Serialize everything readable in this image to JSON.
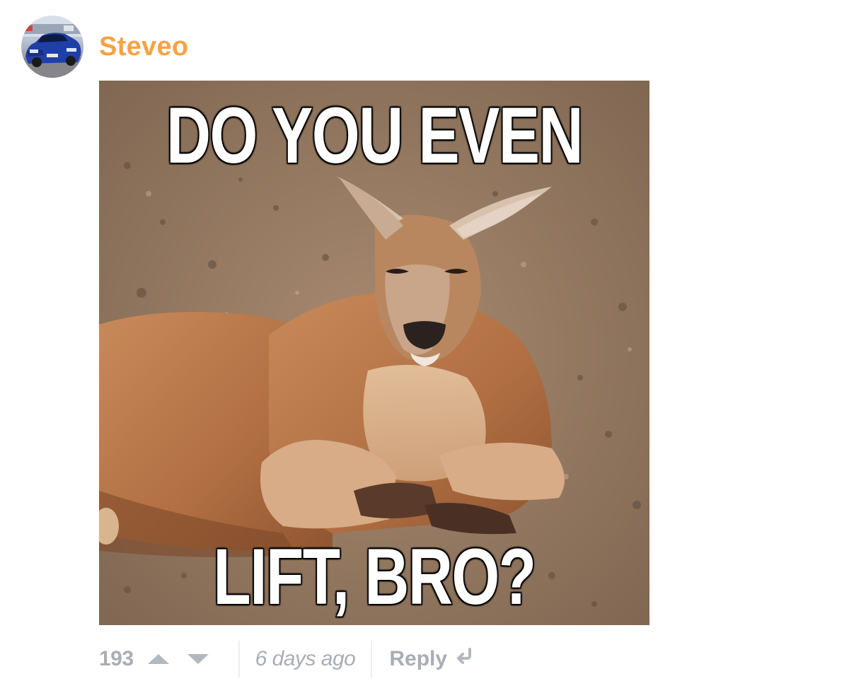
{
  "comment": {
    "author": "Steveo",
    "author_color": "#f7a246",
    "avatar": "avatar-blue-car",
    "image": {
      "top_text": "DO YOU EVEN",
      "bottom_text": "LIFT, BRO?",
      "subject": "kangaroo"
    },
    "footer": {
      "votes": "193",
      "upvote_icon": "triangle-up-icon",
      "downvote_icon": "triangle-down-icon",
      "timestamp": "6 days ago",
      "reply_label": "Reply",
      "reply_icon": "reply-arrow-icon"
    }
  }
}
